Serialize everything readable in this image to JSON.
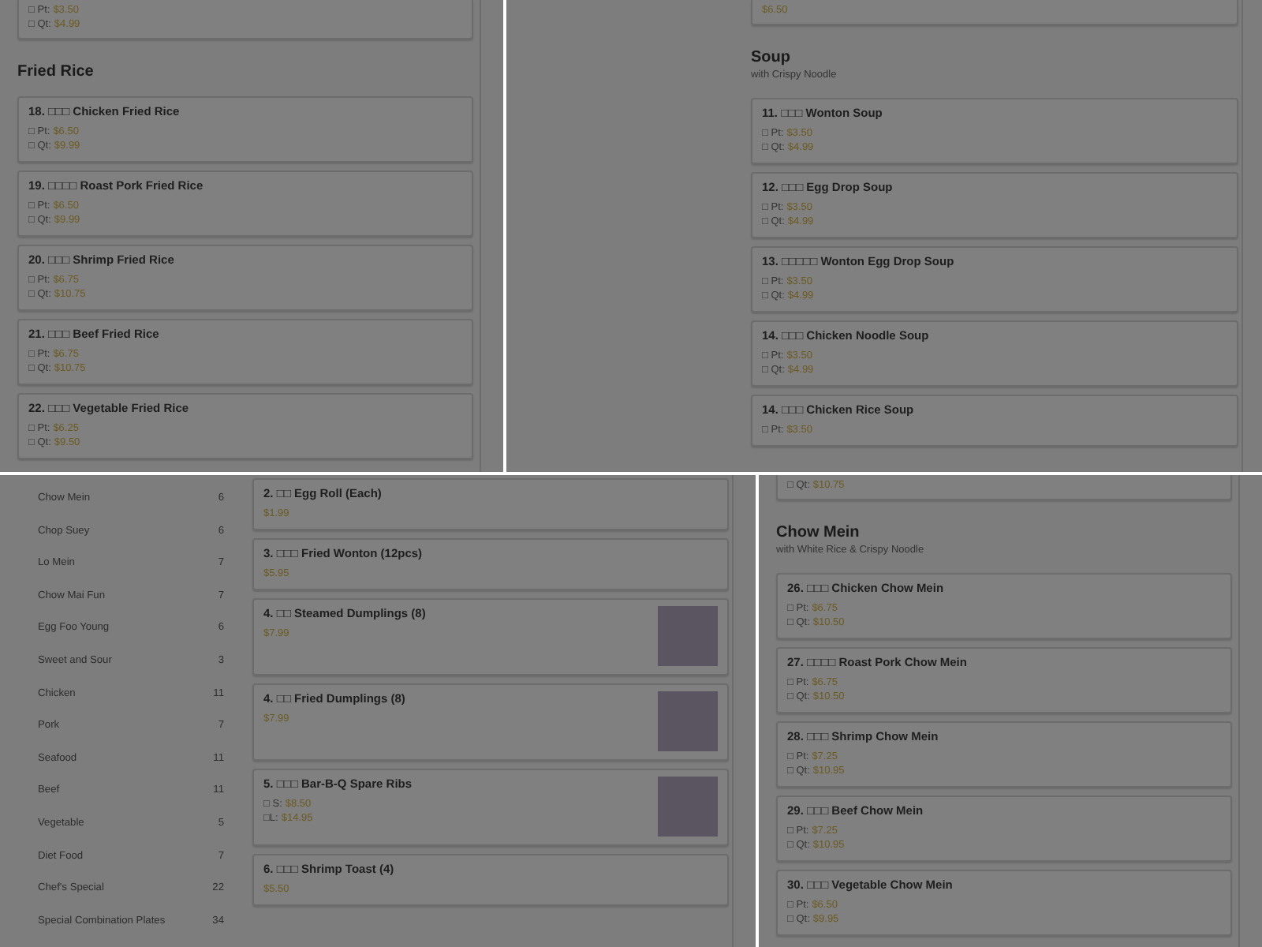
{
  "panels": [
    {
      "kind": "plain",
      "blocks": [
        {
          "kind": "item",
          "cut": true,
          "prices": [
            {
              "label": "□ Pt:",
              "amount": "$3.50"
            },
            {
              "label": "□ Qt:",
              "amount": "$4.99"
            }
          ]
        },
        {
          "kind": "heading",
          "title": "Fried Rice"
        },
        {
          "kind": "item",
          "name": "18. □□□ Chicken Fried Rice",
          "prices": [
            {
              "label": "□ Pt:",
              "amount": "$6.50"
            },
            {
              "label": "□ Qt:",
              "amount": "$9.99"
            }
          ]
        },
        {
          "kind": "item",
          "name": "19. □□□□ Roast Pork Fried Rice",
          "prices": [
            {
              "label": "□ Pt:",
              "amount": "$6.50"
            },
            {
              "label": "□ Qt:",
              "amount": "$9.99"
            }
          ]
        },
        {
          "kind": "item",
          "name": "20. □□□ Shrimp Fried Rice",
          "prices": [
            {
              "label": "□ Pt:",
              "amount": "$6.75"
            },
            {
              "label": "□ Qt:",
              "amount": "$10.75"
            }
          ]
        },
        {
          "kind": "item",
          "name": "21. □□□ Beef Fried Rice",
          "prices": [
            {
              "label": "□ Pt:",
              "amount": "$6.75"
            },
            {
              "label": "□ Qt:",
              "amount": "$10.75"
            }
          ]
        },
        {
          "kind": "item",
          "name": "22. □□□ Vegetable Fried Rice",
          "prices": [
            {
              "label": "□ Pt:",
              "amount": "$6.25"
            },
            {
              "label": "□ Qt:",
              "amount": "$9.50"
            }
          ]
        }
      ]
    },
    {
      "kind": "offset",
      "blocks": [
        {
          "kind": "item",
          "cut": true,
          "prices": [
            {
              "amount": "$6.50"
            }
          ]
        },
        {
          "kind": "heading",
          "title": "Soup",
          "subtitle": "with Crispy Noodle"
        },
        {
          "kind": "item",
          "name": "11. □□□ Wonton Soup",
          "prices": [
            {
              "label": "□ Pt:",
              "amount": "$3.50"
            },
            {
              "label": "□ Qt:",
              "amount": "$4.99"
            }
          ]
        },
        {
          "kind": "item",
          "name": "12. □□□ Egg Drop Soup",
          "prices": [
            {
              "label": "□ Pt:",
              "amount": "$3.50"
            },
            {
              "label": "□ Qt:",
              "amount": "$4.99"
            }
          ]
        },
        {
          "kind": "item",
          "name": "13. □□□□□ Wonton Egg Drop Soup",
          "prices": [
            {
              "label": "□ Pt:",
              "amount": "$3.50"
            },
            {
              "label": "□ Qt:",
              "amount": "$4.99"
            }
          ]
        },
        {
          "kind": "item",
          "name": "14. □□□ Chicken Noodle Soup",
          "prices": [
            {
              "label": "□ Pt:",
              "amount": "$3.50"
            },
            {
              "label": "□ Qt:",
              "amount": "$4.99"
            }
          ]
        },
        {
          "kind": "item",
          "name": "14. □□□ Chicken Rice Soup",
          "prices": [
            {
              "label": "□ Pt:",
              "amount": "$3.50"
            }
          ]
        }
      ]
    },
    {
      "kind": "sidebar",
      "categories": [
        {
          "name": "Chow Mein",
          "count": "6"
        },
        {
          "name": "Chop Suey",
          "count": "6"
        },
        {
          "name": "Lo Mein",
          "count": "7"
        },
        {
          "name": "Chow Mai Fun",
          "count": "7"
        },
        {
          "name": "Egg Foo Young",
          "count": "6"
        },
        {
          "name": "Sweet and Sour",
          "count": "3"
        },
        {
          "name": "Chicken",
          "count": "11"
        },
        {
          "name": "Pork",
          "count": "7"
        },
        {
          "name": "Seafood",
          "count": "11"
        },
        {
          "name": "Beef",
          "count": "11"
        },
        {
          "name": "Vegetable",
          "count": "5"
        },
        {
          "name": "Diet Food",
          "count": "7"
        },
        {
          "name": "Chef's Special",
          "count": "22"
        },
        {
          "name": "Special Combination Plates",
          "count": "34"
        }
      ],
      "blocks": [
        {
          "kind": "item",
          "name": "2. □□ Egg Roll (Each)",
          "prices": [
            {
              "amount": "$1.99"
            }
          ]
        },
        {
          "kind": "item",
          "name": "3. □□□ Fried Wonton (12pcs)",
          "prices": [
            {
              "amount": "$5.95"
            }
          ]
        },
        {
          "kind": "item",
          "name": "4. □□ Steamed Dumplings (8)",
          "photo": true,
          "prices": [
            {
              "amount": "$7.99"
            }
          ]
        },
        {
          "kind": "item",
          "name": "4. □□ Fried Dumplings (8)",
          "photo": true,
          "prices": [
            {
              "amount": "$7.99"
            }
          ]
        },
        {
          "kind": "item",
          "name": "5. □□□ Bar-B-Q Spare Ribs",
          "photo": true,
          "prices": [
            {
              "label": "□ S:",
              "amount": "$8.50"
            },
            {
              "label": "□L:",
              "amount": "$14.95"
            }
          ]
        },
        {
          "kind": "item",
          "name": "6. □□□ Shrimp Toast (4)",
          "prices": [
            {
              "amount": "$5.50"
            }
          ]
        }
      ]
    },
    {
      "kind": "plain",
      "blocks": [
        {
          "kind": "item",
          "cut": true,
          "prices": [
            {
              "label": "□ Qt:",
              "amount": "$10.75"
            }
          ]
        },
        {
          "kind": "heading",
          "title": "Chow Mein",
          "subtitle": "with White Rice & Crispy Noodle"
        },
        {
          "kind": "item",
          "name": "26. □□□ Chicken Chow Mein",
          "prices": [
            {
              "label": "□ Pt:",
              "amount": "$6.75"
            },
            {
              "label": "□ Qt:",
              "amount": "$10.50"
            }
          ]
        },
        {
          "kind": "item",
          "name": "27. □□□□ Roast Pork Chow Mein",
          "prices": [
            {
              "label": "□ Pt:",
              "amount": "$6.75"
            },
            {
              "label": "□ Qt:",
              "amount": "$10.50"
            }
          ]
        },
        {
          "kind": "item",
          "name": "28. □□□ Shrimp Chow Mein",
          "prices": [
            {
              "label": "□ Pt:",
              "amount": "$7.25"
            },
            {
              "label": "□ Qt:",
              "amount": "$10.95"
            }
          ]
        },
        {
          "kind": "item",
          "name": "29. □□□ Beef Chow Mein",
          "prices": [
            {
              "label": "□ Pt:",
              "amount": "$7.25"
            },
            {
              "label": "□ Qt:",
              "amount": "$10.95"
            }
          ]
        },
        {
          "kind": "item",
          "name": "30. □□□ Vegetable Chow Mein",
          "prices": [
            {
              "label": "□ Pt:",
              "amount": "$6.50"
            },
            {
              "label": "□ Qt:",
              "amount": "$9.95"
            }
          ]
        }
      ]
    }
  ]
}
